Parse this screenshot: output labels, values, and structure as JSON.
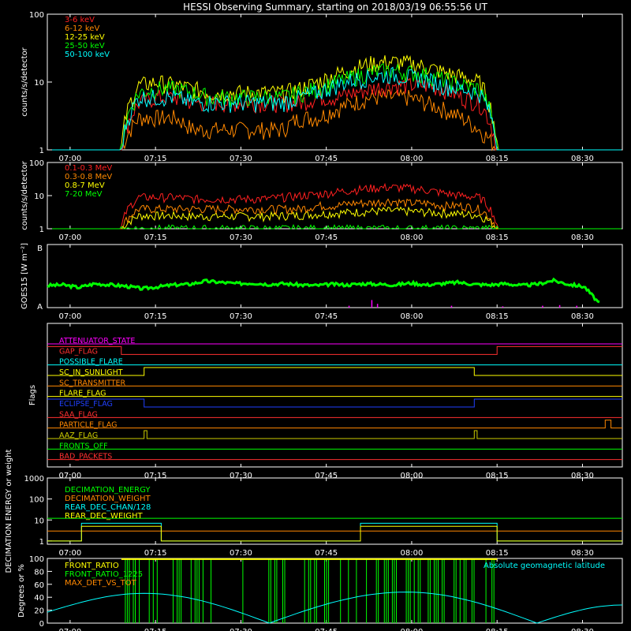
{
  "title": "HESSI Observing Summary, starting on 2018/03/19 06:55:56 UT",
  "time_axis": {
    "ticks": [
      "07:00",
      "07:15",
      "07:30",
      "07:45",
      "08:00",
      "08:15",
      "08:30"
    ]
  },
  "chart_data": [
    {
      "type": "line",
      "name": "low-energy-rates",
      "ylabel": "counts/s/detector",
      "yscale": "log",
      "ylim": [
        1,
        100
      ],
      "yticks": [
        "1",
        "10",
        "100"
      ],
      "data_start": "07:09",
      "data_end": "08:15",
      "series": [
        {
          "name": "3-6 keV",
          "color": "#ff2020",
          "values": [
            1,
            5,
            6,
            6,
            5,
            5,
            5,
            5,
            5,
            5,
            5,
            6,
            6,
            7,
            8,
            9,
            9,
            9,
            8,
            6,
            5,
            1
          ]
        },
        {
          "name": "6-12 keV",
          "color": "#ff8800",
          "values": [
            1,
            3,
            3,
            3,
            2,
            2,
            2,
            2,
            2,
            2,
            3,
            3,
            4,
            5,
            6,
            6,
            6,
            5,
            4,
            3,
            2,
            1
          ]
        },
        {
          "name": "12-25 keV",
          "color": "#ffff00",
          "values": [
            1,
            9,
            10,
            9,
            8,
            7,
            7,
            7,
            7,
            7,
            8,
            10,
            13,
            16,
            19,
            20,
            19,
            17,
            14,
            12,
            10,
            1
          ]
        },
        {
          "name": "25-50 keV",
          "color": "#00ff00",
          "values": [
            1,
            7,
            8,
            8,
            7,
            6,
            6,
            6,
            6,
            6,
            7,
            8,
            10,
            12,
            14,
            15,
            14,
            13,
            11,
            9,
            8,
            1
          ]
        },
        {
          "name": "50-100 keV",
          "color": "#00ffff",
          "values": [
            1,
            6,
            6,
            6,
            5,
            5,
            5,
            5,
            5,
            5,
            6,
            7,
            9,
            11,
            12,
            13,
            12,
            11,
            9,
            8,
            7,
            1
          ]
        }
      ]
    },
    {
      "type": "line",
      "name": "high-energy-rates",
      "ylabel": "counts/s/detector",
      "yscale": "log",
      "ylim": [
        1,
        100
      ],
      "yticks": [
        "1",
        "10",
        "100"
      ],
      "data_start": "07:09",
      "data_end": "08:15",
      "series": [
        {
          "name": "0.1-0.3 MeV",
          "color": "#ff2020",
          "values": [
            1,
            9,
            9,
            9,
            8,
            8,
            8,
            8,
            8,
            9,
            10,
            11,
            13,
            15,
            17,
            18,
            17,
            15,
            12,
            10,
            9,
            1
          ]
        },
        {
          "name": "0.3-0.8 MeV",
          "color": "#ff8800",
          "values": [
            1,
            4,
            4,
            4,
            4,
            4,
            4,
            4,
            4,
            4,
            4,
            5,
            5,
            6,
            6,
            7,
            6,
            6,
            5,
            5,
            4,
            1
          ]
        },
        {
          "name": "0.8-7 MeV",
          "color": "#ffff00",
          "values": [
            1,
            2.5,
            2.5,
            2.5,
            2.4,
            2.4,
            2.4,
            2.4,
            2.4,
            2.5,
            2.6,
            2.8,
            3,
            3.2,
            3.4,
            3.5,
            3.4,
            3.2,
            3,
            2.8,
            2.6,
            1
          ]
        },
        {
          "name": "7-20 MeV",
          "color": "#00ff00",
          "values": [
            1,
            1,
            1,
            1,
            1,
            1,
            1,
            1,
            1,
            1,
            1,
            1,
            1,
            1,
            1,
            1,
            1,
            1,
            1,
            1,
            1,
            1
          ]
        }
      ]
    },
    {
      "type": "line",
      "name": "goes-flux",
      "ylabel": "GOES15 [W m⁻²]",
      "yticks": [
        "A",
        "B"
      ],
      "series": [
        {
          "name": "goes-long",
          "color": "#00ff00",
          "values": [
            0.35,
            0.36,
            0.32,
            0.38,
            0.36,
            0.34,
            0.3,
            0.33,
            0.36,
            0.37,
            0.42,
            0.4,
            0.38,
            0.39,
            0.37,
            0.38,
            0.36,
            0.35,
            0.37,
            0.36,
            0.38,
            0.37,
            0.36,
            0.39,
            0.36,
            0.38,
            0.4,
            0.37,
            0.36,
            0.38,
            0.35,
            0.37,
            0.43,
            0.37,
            0.33,
            0.05
          ]
        },
        {
          "name": "goes-short",
          "color": "#ff00ff",
          "spikes": [
            [
              "07:49",
              0.03
            ],
            [
              "07:53",
              0.12
            ],
            [
              "07:54",
              0.06
            ],
            [
              "08:07",
              0.03
            ],
            [
              "08:16",
              0.02
            ],
            [
              "08:23",
              0.03
            ],
            [
              "08:26",
              0.04
            ],
            [
              "08:29",
              0.03
            ]
          ]
        }
      ]
    },
    {
      "type": "line",
      "name": "flags",
      "ylabel": "Flags",
      "series": [
        {
          "name": "ATTENUATOR_STATE",
          "color": "#ff00ff",
          "segments": [
            [
              "06:56",
              "08:37",
              0
            ]
          ]
        },
        {
          "name": "GAP_FLAG",
          "color": "#ff3030",
          "segments": [
            [
              "06:56",
              "07:09",
              1
            ],
            [
              "07:09",
              "08:15",
              0
            ],
            [
              "08:15",
              "08:37",
              1
            ]
          ]
        },
        {
          "name": "POSSIBLE_FLARE",
          "color": "#00ffff",
          "segments": [
            [
              "06:56",
              "08:37",
              0
            ]
          ]
        },
        {
          "name": "SC_IN_SUNLIGHT",
          "color": "#ffff00",
          "segments": [
            [
              "06:56",
              "07:13",
              0
            ],
            [
              "07:13",
              "08:11",
              1
            ],
            [
              "08:11",
              "08:37",
              0
            ]
          ]
        },
        {
          "name": "SC_TRANSMITTER",
          "color": "#ff8800",
          "segments": [
            [
              "06:56",
              "08:37",
              0
            ]
          ]
        },
        {
          "name": "FLARE_FLAG",
          "color": "#ffff00",
          "segments": [
            [
              "06:56",
              "08:37",
              0
            ]
          ]
        },
        {
          "name": "ECLIPSE_FLAG",
          "color": "#2040ff",
          "segments": [
            [
              "06:56",
              "07:13",
              1
            ],
            [
              "07:13",
              "08:11",
              0
            ],
            [
              "08:11",
              "08:37",
              1
            ]
          ]
        },
        {
          "name": "SAA_FLAG",
          "color": "#ff3030",
          "segments": [
            [
              "06:56",
              "08:37",
              0
            ]
          ]
        },
        {
          "name": "PARTICLE_FLAG",
          "color": "#ff8800",
          "segments": [
            [
              "06:56",
              "08:34",
              0
            ],
            [
              "08:34",
              "08:35",
              1
            ],
            [
              "08:35",
              "08:37",
              0
            ]
          ]
        },
        {
          "name": "AAZ_FLAG",
          "color": "#cccc00",
          "segments": [
            [
              "06:56",
              "07:13",
              0
            ],
            [
              "07:13",
              "07:13.5",
              1
            ],
            [
              "07:13.5",
              "08:11",
              0
            ],
            [
              "08:11",
              "08:11.5",
              1
            ],
            [
              "08:11.5",
              "08:37",
              0
            ]
          ]
        },
        {
          "name": "FRONTS_OFF",
          "color": "#00ff00",
          "segments": [
            [
              "06:56",
              "08:37",
              0
            ]
          ]
        },
        {
          "name": "BAD_PACKETS",
          "color": "#ff3030",
          "segments": [
            [
              "06:56",
              "08:37",
              0
            ]
          ]
        }
      ]
    },
    {
      "type": "line",
      "name": "decimation",
      "ylabel": "DECIMATION ENERGY or weight",
      "yscale": "log",
      "ylim": [
        0.7,
        1000
      ],
      "yticks": [
        "1",
        "10",
        "100",
        "1000"
      ],
      "series": [
        {
          "name": "DECIMATION_ENERGY",
          "color": "#00ff00",
          "segments": [
            [
              "06:56",
              "08:37",
              12
            ]
          ]
        },
        {
          "name": "DECIMATION_WEIGHT",
          "color": "#ff8800",
          "segments": [
            [
              "06:56",
              "08:37",
              3
            ]
          ]
        },
        {
          "name": "REAR_DEC_CHAN/128",
          "color": "#00ffff",
          "segments": [
            [
              "06:56",
              "07:02",
              1
            ],
            [
              "07:02",
              "07:16",
              7
            ],
            [
              "07:16",
              "07:51",
              1
            ],
            [
              "07:51",
              "08:15",
              7
            ],
            [
              "08:15",
              "08:37",
              1
            ]
          ]
        },
        {
          "name": "REAR_DEC_WEIGHT",
          "color": "#ffff00",
          "segments": [
            [
              "06:56",
              "07:02",
              1
            ],
            [
              "07:02",
              "07:16",
              5
            ],
            [
              "07:16",
              "07:51",
              1
            ],
            [
              "07:51",
              "08:15",
              5
            ],
            [
              "08:15",
              "08:37",
              1
            ]
          ]
        }
      ]
    },
    {
      "type": "line",
      "name": "ratios",
      "ylabel": "Degrees or %",
      "ylim": [
        0,
        100
      ],
      "yticks": [
        "0",
        "20",
        "40",
        "60",
        "80",
        "100"
      ],
      "right_label": "Absolute geomagnetic latitude",
      "series": [
        {
          "name": "FRONT_RATIO",
          "color": "#ffff00",
          "segments": [
            [
              "07:09",
              "08:15",
              99
            ]
          ]
        },
        {
          "name": "FRONT_RATIO_1225",
          "color": "#00ff00",
          "value": 100,
          "gaps": [
            [
              "06:56",
              "07:09"
            ],
            [
              "07:16",
              "07:18"
            ],
            [
              "07:26",
              "07:30"
            ],
            [
              "07:32",
              "07:34"
            ],
            [
              "07:38",
              "07:40"
            ],
            [
              "08:15",
              "08:37"
            ]
          ]
        },
        {
          "name": "MAX_DET_VS_TOT",
          "color": "#ff8800",
          "segments": []
        },
        {
          "name": "geomag-latitude",
          "color": "#00ffff",
          "points": [
            [
              "06:56",
              17
            ],
            [
              "07:13",
              46
            ],
            [
              "07:35",
              0
            ],
            [
              "07:59",
              48
            ],
            [
              "08:22",
              0
            ],
            [
              "08:37",
              28
            ]
          ]
        }
      ]
    }
  ]
}
